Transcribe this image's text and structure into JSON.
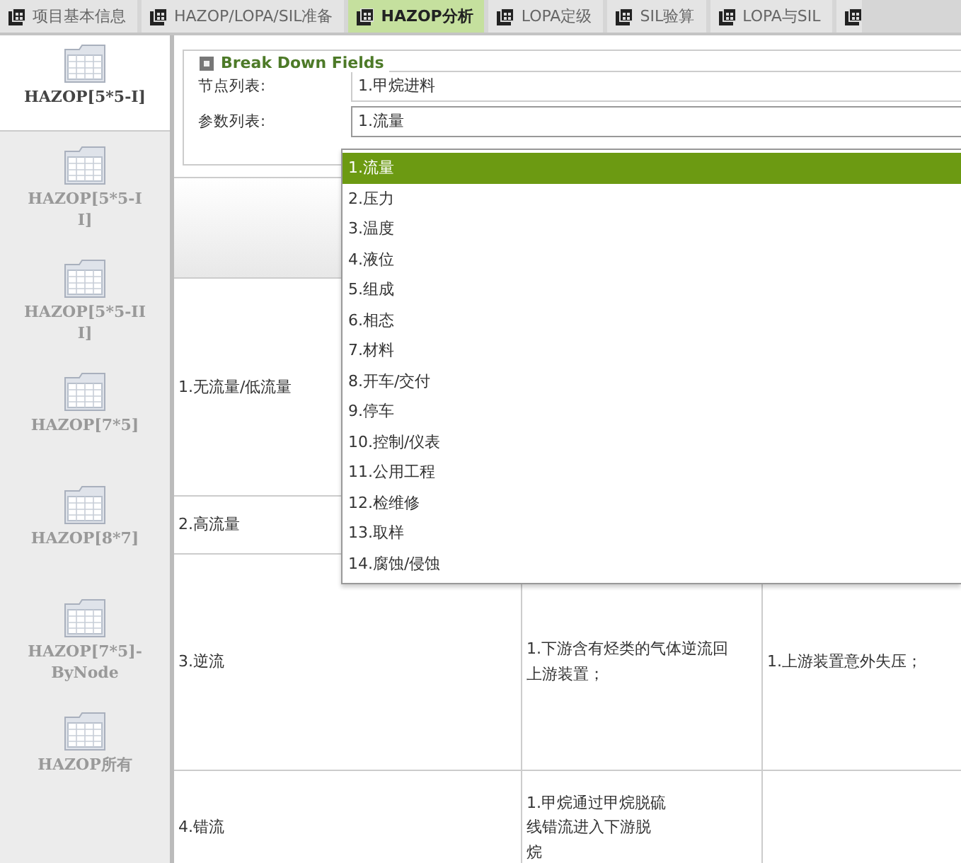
{
  "tabs": [
    {
      "label": "项目基本信息",
      "selected": false
    },
    {
      "label": "HAZOP/LOPA/SIL准备",
      "selected": false
    },
    {
      "label": "HAZOP分析",
      "selected": true
    },
    {
      "label": "LOPA定级",
      "selected": false
    },
    {
      "label": "SIL验算",
      "selected": false
    },
    {
      "label": "LOPA与SIL",
      "selected": false
    },
    {
      "selected": false
    }
  ],
  "sidebar": {
    "items": [
      {
        "label": "HAZOP[5*5-I]",
        "selected": true
      },
      {
        "label": "HAZOP[5*5-I\nI]",
        "selected": false
      },
      {
        "label": "HAZOP[5*5-II\nI]",
        "selected": false
      },
      {
        "label": "HAZOP[7*5]",
        "selected": false
      },
      {
        "label": "HAZOP[8*7]",
        "selected": false
      },
      {
        "label": "HAZOP[7*5]-\nByNode",
        "selected": false
      },
      {
        "label": "HAZOP所有",
        "selected": false
      }
    ]
  },
  "breakdown": {
    "title": "Break Down Fields",
    "fields": [
      {
        "label": "节点列表:",
        "value": "1.甲烷进料"
      },
      {
        "label": "参数列表:",
        "value": "1.流量"
      }
    ],
    "dropdown": [
      {
        "label": "1.流量",
        "selected": true
      },
      {
        "label": "2.压力",
        "selected": false
      },
      {
        "label": "3.温度",
        "selected": false
      },
      {
        "label": "4.液位",
        "selected": false
      },
      {
        "label": "5.组成",
        "selected": false
      },
      {
        "label": "6.相态",
        "selected": false
      },
      {
        "label": "7.材料",
        "selected": false
      },
      {
        "label": "8.开车/交付",
        "selected": false
      },
      {
        "label": "9.停车",
        "selected": false
      },
      {
        "label": "10.控制/仪表",
        "selected": false
      },
      {
        "label": "11.公用工程",
        "selected": false
      },
      {
        "label": "12.检维修",
        "selected": false
      },
      {
        "label": "13.取样",
        "selected": false
      },
      {
        "label": "14.腐蚀/侵蚀",
        "selected": false
      }
    ]
  },
  "table": {
    "rows": [
      {
        "cells": [
          "1.无流量/低流量"
        ]
      },
      {
        "cells": [
          "2.高流量"
        ]
      },
      {
        "cells": [
          "3.逆流",
          "1.下游含有烃类的气体逆流回上游装置；",
          "1.上游装置意外失压；"
        ]
      },
      {
        "cells": [
          "4.错流",
          [
            "1.甲烷通过甲烷脱硫",
            "线错流进入下游脱",
            "烷"
          ]
        ]
      }
    ]
  }
}
